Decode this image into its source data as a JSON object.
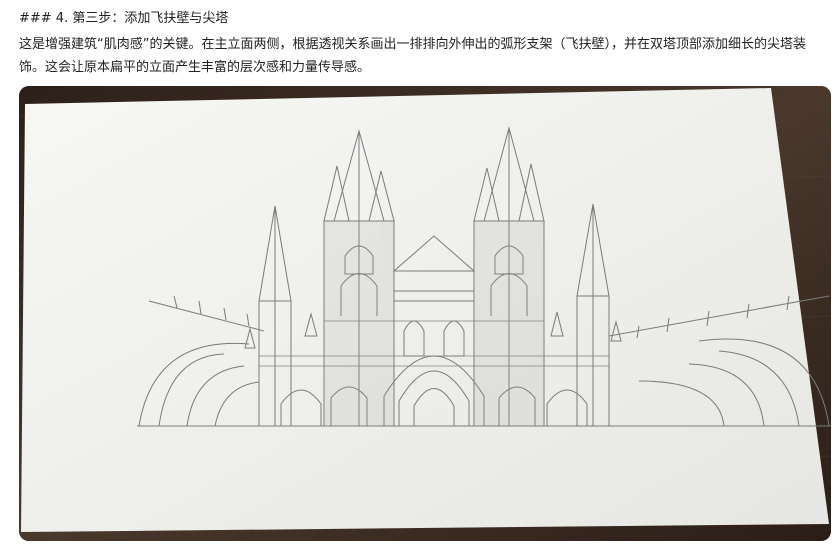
{
  "section": {
    "heading": "### 4. 第三步：添加飞扶壁与尖塔",
    "paragraph": "这是增强建筑“肌肉感”的关键。在主立面两侧，根据透视关系画出一排排向外伸出的弧形支架（飞扶壁），并在双塔顶部添加细长的尖塔装饰。这会让原本扁平的立面产生丰富的层次感和力量传导感。"
  },
  "image": {
    "subject": "cathedral-sketch-photo",
    "colors": {
      "table": "#3a2b22",
      "paper": "#f3f3f1",
      "pencil": "#7a7a7a"
    }
  }
}
